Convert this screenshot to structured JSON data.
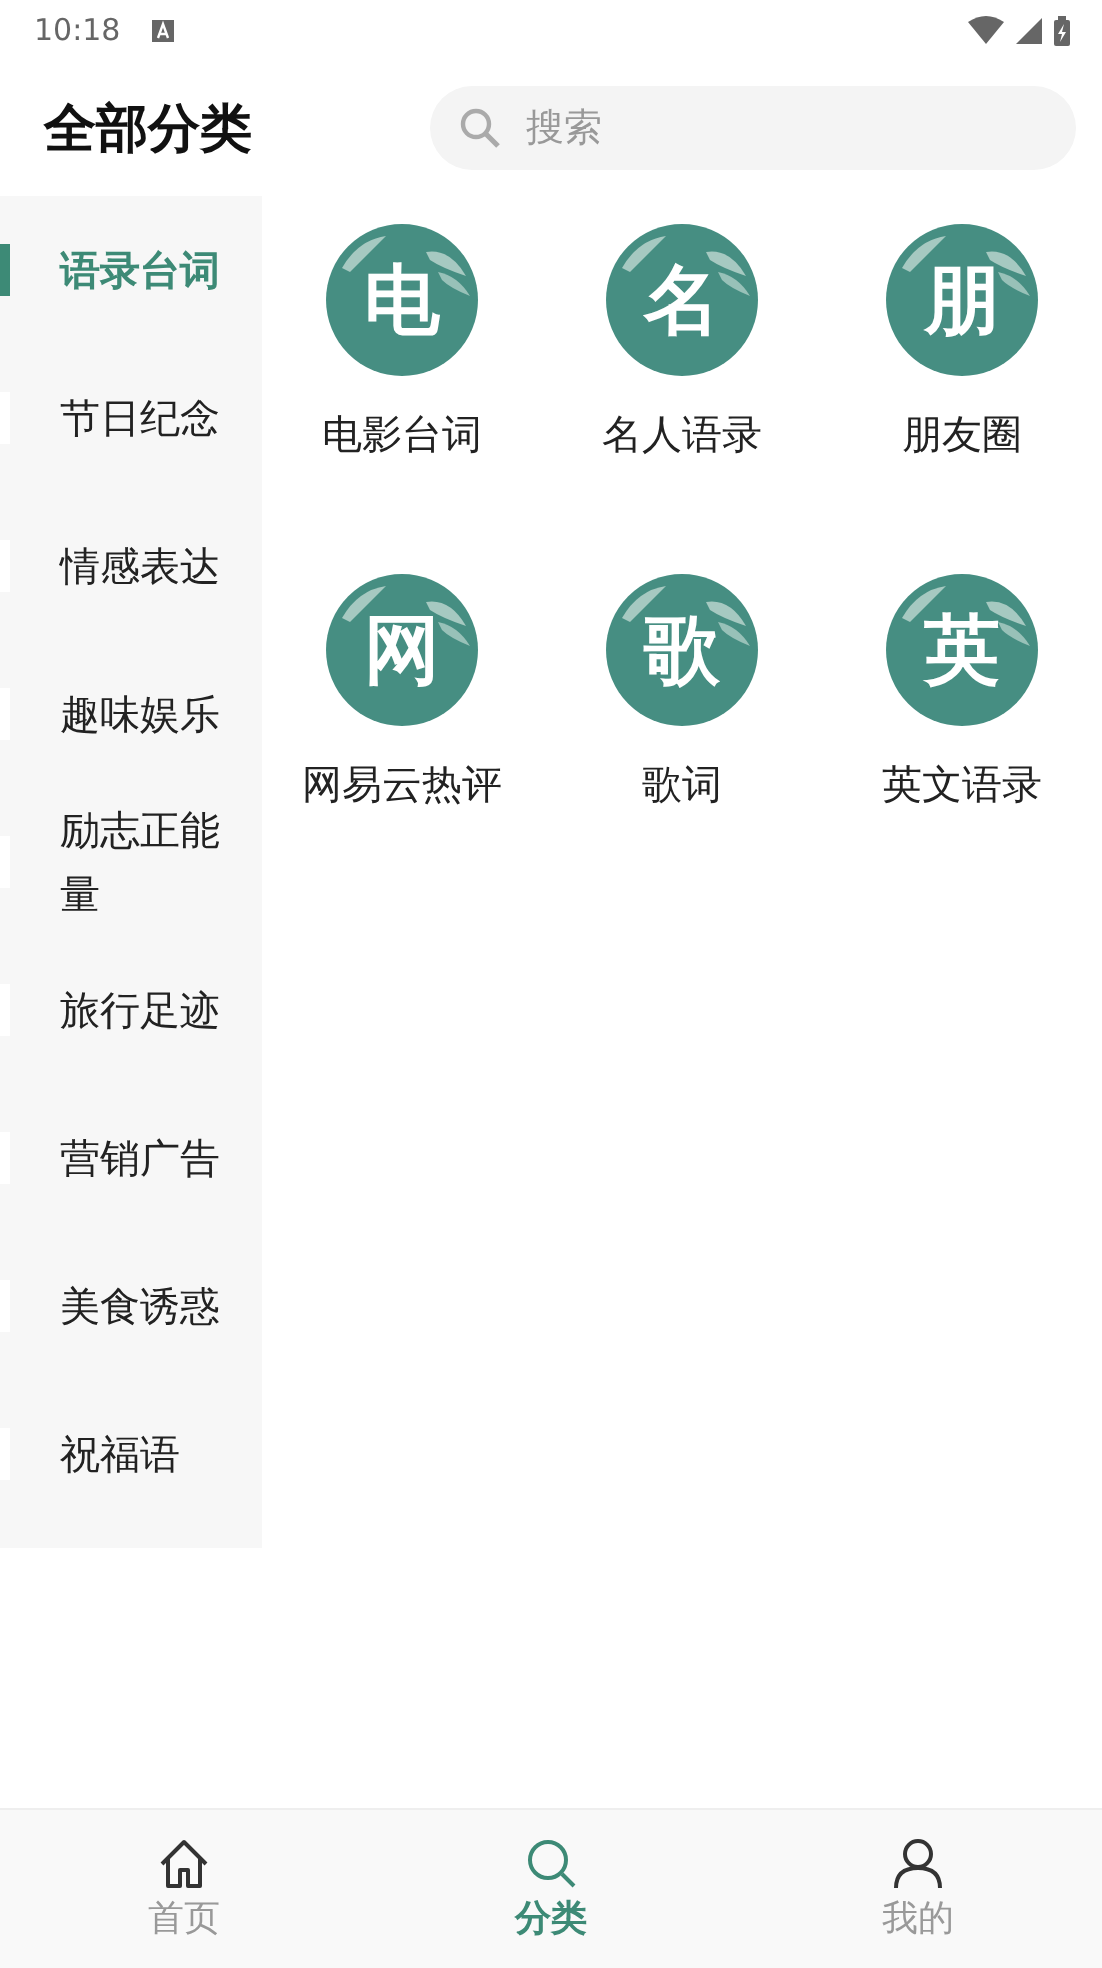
{
  "status_bar": {
    "time": "10:18"
  },
  "header": {
    "title": "全部分类",
    "search": {
      "placeholder": "搜索"
    }
  },
  "sidebar": {
    "items": [
      {
        "label": "语录台词",
        "selected": true
      },
      {
        "label": "节日纪念",
        "selected": false
      },
      {
        "label": "情感表达",
        "selected": false
      },
      {
        "label": "趣味娱乐",
        "selected": false
      },
      {
        "label": "励志正能量",
        "selected": false
      },
      {
        "label": "旅行足迹",
        "selected": false
      },
      {
        "label": "营销广告",
        "selected": false
      },
      {
        "label": "美食诱惑",
        "selected": false
      },
      {
        "label": "祝福语",
        "selected": false
      }
    ]
  },
  "categories": [
    {
      "glyph": "电",
      "label": "电影台词"
    },
    {
      "glyph": "名",
      "label": "名人语录"
    },
    {
      "glyph": "朋",
      "label": "朋友圈"
    },
    {
      "glyph": "网",
      "label": "网易云热评"
    },
    {
      "glyph": "歌",
      "label": "歌词"
    },
    {
      "glyph": "英",
      "label": "英文语录"
    }
  ],
  "bottom_nav": [
    {
      "label": "首页",
      "kind": "home",
      "selected": false
    },
    {
      "label": "分类",
      "kind": "search",
      "selected": true
    },
    {
      "label": "我的",
      "kind": "user",
      "selected": false
    }
  ]
}
